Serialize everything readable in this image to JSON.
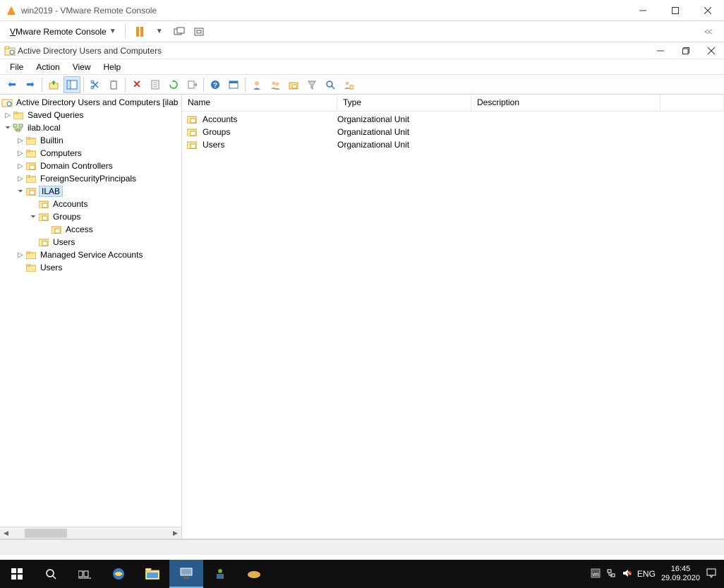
{
  "vmware": {
    "title": "win2019 - VMware Remote Console",
    "menu_label": "VMware Remote Console"
  },
  "ad": {
    "title": "Active Directory Users and Computers",
    "menus": {
      "file": "File",
      "action": "Action",
      "view": "View",
      "help": "Help"
    },
    "tree": {
      "root": "Active Directory Users and Computers [ilab",
      "saved_queries": "Saved Queries",
      "domain": "ilab.local",
      "builtin": "Builtin",
      "computers": "Computers",
      "domain_controllers": "Domain Controllers",
      "fsp": "ForeignSecurityPrincipals",
      "ilab": "ILAB",
      "ilab_accounts": "Accounts",
      "ilab_groups": "Groups",
      "ilab_groups_access": "Access",
      "ilab_users": "Users",
      "msa": "Managed Service Accounts",
      "users": "Users"
    },
    "columns": {
      "name": "Name",
      "type": "Type",
      "description": "Description"
    },
    "rows": [
      {
        "name": "Accounts",
        "type": "Organizational Unit",
        "description": ""
      },
      {
        "name": "Groups",
        "type": "Organizational Unit",
        "description": ""
      },
      {
        "name": "Users",
        "type": "Organizational Unit",
        "description": ""
      }
    ]
  },
  "taskbar": {
    "lang": "ENG",
    "time": "16:45",
    "date": "29.09.2020"
  }
}
